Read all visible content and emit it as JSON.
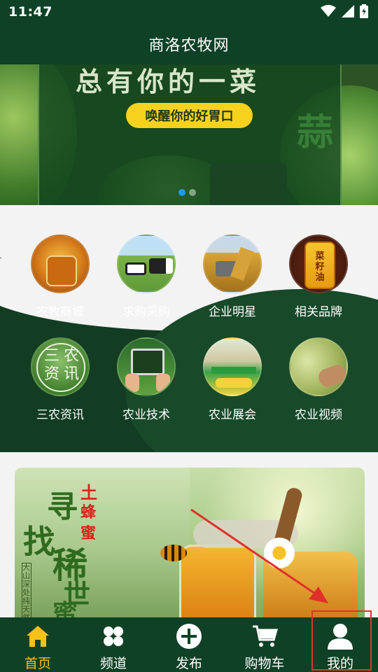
{
  "status_bar": {
    "time": "11:47"
  },
  "header": {
    "title": "商洛农牧网"
  },
  "banner": {
    "headline": "总有你的一菜",
    "cta_label": "唤醒你的好胃口",
    "side_char": "蒜"
  },
  "categories": [
    {
      "label": "农牧商城",
      "icon": "honey-jar-icon"
    },
    {
      "label": "求购采购",
      "icon": "cows-icon"
    },
    {
      "label": "企业明星",
      "icon": "harvester-icon"
    },
    {
      "label": "相关品牌",
      "icon": "oil-barrel-icon"
    },
    {
      "label": "三农资讯",
      "icon": "news-icon",
      "badge_chars": [
        "三",
        "农",
        "资",
        "讯"
      ]
    },
    {
      "label": "农业技术",
      "icon": "smart-farming-icon"
    },
    {
      "label": "农业展会",
      "icon": "expo-icon"
    },
    {
      "label": "农业视频",
      "icon": "video-icon"
    }
  ],
  "promo": {
    "title_chars": [
      "寻",
      "找",
      "稀",
      "世",
      "蜜"
    ],
    "tag_chars": [
      "土",
      "蜂",
      "蜜"
    ],
    "side_text": "大山深处纯天然"
  },
  "tabbar": {
    "items": [
      {
        "label": "首页",
        "icon": "home-icon",
        "active": true
      },
      {
        "label": "频道",
        "icon": "channel-grid-icon",
        "active": false
      },
      {
        "label": "发布",
        "icon": "add-circle-icon",
        "active": false
      },
      {
        "label": "购物车",
        "icon": "cart-icon",
        "active": false
      },
      {
        "label": "我的",
        "icon": "profile-icon",
        "active": false
      }
    ],
    "active_color": "#f6c21a",
    "bar_color": "#0f4126"
  }
}
